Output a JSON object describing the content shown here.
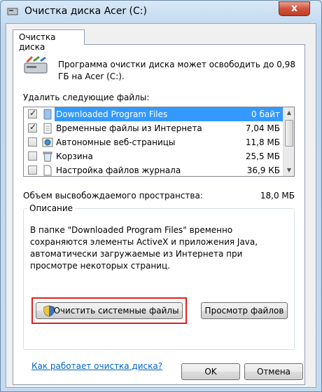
{
  "window": {
    "title": "Очистка диска Acer (C:)",
    "close_glyph": "x"
  },
  "tab": {
    "label": "Очистка диска"
  },
  "intro": {
    "text": "Программа очистки диска может освободить до 0,98 ГБ на Acer (C:)."
  },
  "files": {
    "label": "Удалить следующие файлы:",
    "items": [
      {
        "name": "Downloaded Program Files",
        "size": "0 байт",
        "checked": true,
        "selected": true
      },
      {
        "name": "Временные файлы из Интернета",
        "size": "7,04 МБ",
        "checked": true,
        "selected": false
      },
      {
        "name": "Автономные веб-страницы",
        "size": "11,8 МБ",
        "checked": false,
        "selected": false
      },
      {
        "name": "Корзина",
        "size": "25,5 МБ",
        "checked": false,
        "selected": false
      },
      {
        "name": "Настройка файлов журнала",
        "size": "36,9 КБ",
        "checked": false,
        "selected": false
      }
    ]
  },
  "space": {
    "label": "Объем высвобождаемого пространства:",
    "value": "18,0 МБ"
  },
  "description": {
    "legend": "Описание",
    "text": "В папке \"Downloaded Program Files\" временно сохраняются элементы ActiveX и приложения Java, автоматически загружаемые из Интернета при просмотре некоторых страниц."
  },
  "buttons": {
    "clean_system": "Очистить системные файлы",
    "view_files": "Просмотр файлов",
    "ok": "OK",
    "cancel": "Отмена"
  },
  "help_link": "Как работает очистка диска?",
  "colors": {
    "selection": "#3399ff",
    "highlight_frame": "#e02020",
    "link": "#0066cc"
  }
}
